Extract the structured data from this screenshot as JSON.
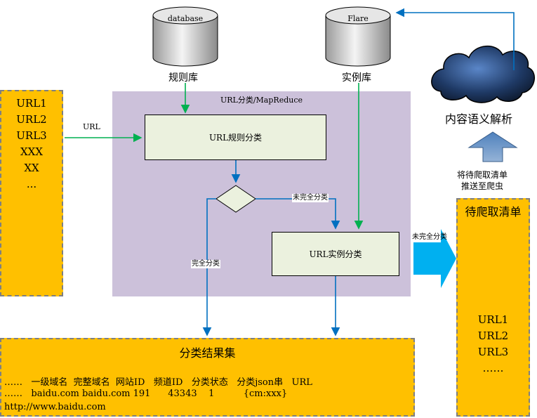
{
  "database_label": "database",
  "rule_lib_label": "规则库",
  "flare_label": "Flare",
  "instance_lib_label": "实例库",
  "url_list": [
    "URL1",
    "URL2",
    "URL3",
    "XXX",
    "XX",
    "..."
  ],
  "url_edge_label": "URL",
  "mapreduce_title": "URL分类/MapReduce",
  "rule_classify": "URL规则分类",
  "instance_classify": "URL实例分类",
  "incomplete_label_1": "未完全分类",
  "incomplete_label_2": "未完全分类",
  "complete_label": "完全分类",
  "results": {
    "title": "分类结果集",
    "header_row": "……   一级域名  完整域名  网站ID   频道ID   分类状态   分类json串   URL",
    "data_row": "……   baidu.com baidu.com 191      43343    1          {cm:xxx}",
    "data_row_2": "http://www.baidu.com"
  },
  "cloud_label": "内容语义解析",
  "push_note_1": "将待爬取清单",
  "push_note_2": "推送至爬虫",
  "pending": {
    "title": "待爬取清单",
    "items": [
      "URL1",
      "URL2",
      "URL3",
      "……"
    ]
  },
  "colors": {
    "orange": "#FFC000",
    "purple": "#CCC1DA",
    "box": "#EBF1DE",
    "green_arrow": "#00B050",
    "blue_arrow": "#0070C0",
    "cyan_arrow": "#00B0F0"
  }
}
